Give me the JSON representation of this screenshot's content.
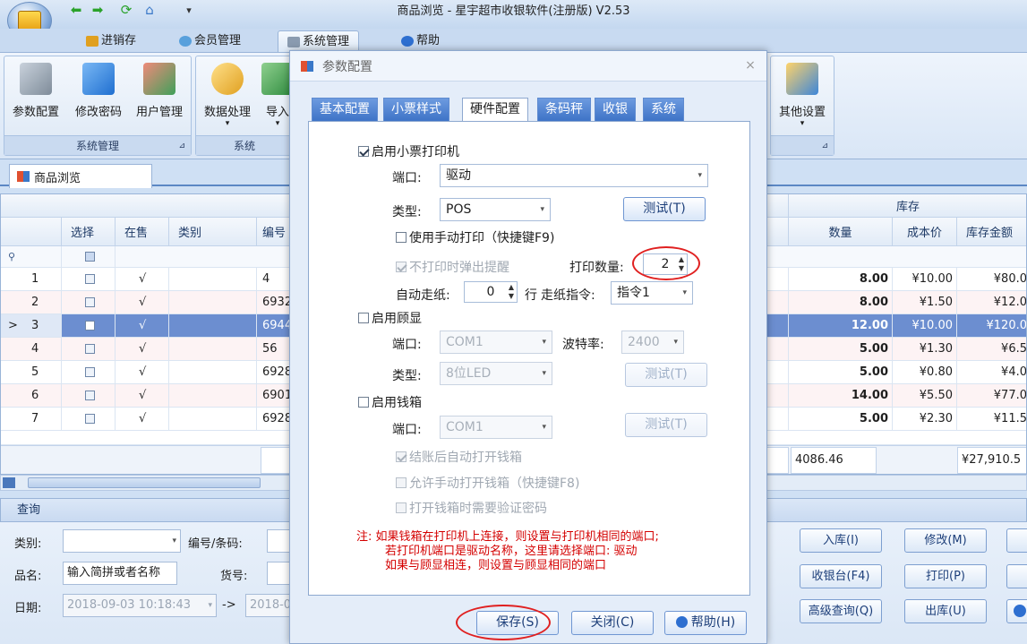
{
  "window": {
    "title": "商品浏览 - 星宇超市收银软件(注册版) V2.53"
  },
  "ribbon_tabs": [
    {
      "label": "进销存"
    },
    {
      "label": "会员管理"
    },
    {
      "label": "系统管理"
    },
    {
      "label": "帮助"
    }
  ],
  "ribbon": {
    "group1_label": "系统管理",
    "group2_label": "系统",
    "buttons": {
      "params": "参数配置",
      "password": "修改密码",
      "users": "用户管理",
      "data": "数据处理",
      "import": "导入",
      "other": "其他设置"
    }
  },
  "doc_tab": {
    "label": "商品浏览"
  },
  "grid": {
    "stock_group_header": "库存",
    "headers": {
      "select": "选择",
      "on_sale": "在售",
      "category": "类别",
      "code": "编号",
      "qty": "数量",
      "cost": "成本价",
      "stock_amount": "库存金额"
    },
    "rows": [
      {
        "n": "1",
        "on_sale": "√",
        "code": "4",
        "qty": "8.00",
        "cost": "¥10.00",
        "amount": "¥80.0"
      },
      {
        "n": "2",
        "on_sale": "√",
        "code": "6932",
        "qty": "8.00",
        "cost": "¥1.50",
        "amount": "¥12.0"
      },
      {
        "n": "3",
        "on_sale": "√",
        "code": "6944",
        "qty": "12.00",
        "cost": "¥10.00",
        "amount": "¥120.0"
      },
      {
        "n": "4",
        "on_sale": "√",
        "code": "56",
        "qty": "5.00",
        "cost": "¥1.30",
        "amount": "¥6.5"
      },
      {
        "n": "5",
        "on_sale": "√",
        "code": "6928",
        "qty": "5.00",
        "cost": "¥0.80",
        "amount": "¥4.0"
      },
      {
        "n": "6",
        "on_sale": "√",
        "code": "6901",
        "qty": "14.00",
        "cost": "¥5.50",
        "amount": "¥77.0"
      },
      {
        "n": "7",
        "on_sale": "√",
        "code": "6928",
        "qty": "5.00",
        "cost": "¥2.30",
        "amount": "¥11.5"
      }
    ],
    "current_row_marker": ">",
    "totals": {
      "qty": "4086.46",
      "amount": "¥27,910.5"
    }
  },
  "query": {
    "title": "查询",
    "category_label": "类别:",
    "code_label": "编号/条码:",
    "name_label": "品名:",
    "name_placeholder": "输入简拼或者名称",
    "sku_label": "货号:",
    "date_label": "日期:",
    "date_from": "2018-09-03 10:18:43",
    "date_arrow": "->",
    "date_to": "2018-0",
    "buttons": {
      "stock_in": "入库(I)",
      "modify": "修改(M)",
      "cashier": "收银台(F4)",
      "print": "打印(P)",
      "advanced": "高级查询(Q)",
      "stock_out": "出库(U)"
    }
  },
  "dialog": {
    "title": "参数配置",
    "close": "×",
    "tabs": [
      "基本配置",
      "小票样式",
      "硬件配置",
      "条码秤",
      "收银",
      "系统"
    ],
    "active_tab": "硬件配置",
    "printer": {
      "enable_label": "启用小票打印机",
      "port_label": "端口:",
      "port_value": "驱动",
      "type_label": "类型:",
      "type_value": "POS",
      "test_button": "测试(T)",
      "manual_print_label": "使用手动打印（快捷键F9)",
      "no_print_popup_label": "不打印时弹出提醒",
      "print_count_label": "打印数量:",
      "print_count_value": "2",
      "auto_feed_label": "自动走纸:",
      "auto_feed_value": "0",
      "line_label": "行",
      "feed_cmd_label": "走纸指令:",
      "feed_cmd_value": "指令1"
    },
    "display": {
      "enable_label": "启用顾显",
      "port_label": "端口:",
      "port_value": "COM1",
      "baud_label": "波特率:",
      "baud_value": "2400",
      "type_label": "类型:",
      "type_value": "8位LED",
      "test_button": "测试(T)"
    },
    "cashbox": {
      "enable_label": "启用钱箱",
      "port_label": "端口:",
      "port_value": "COM1",
      "test_button": "测试(T)",
      "auto_open_label": "结账后自动打开钱箱",
      "manual_open_label": "允许手动打开钱箱（快捷键F8)",
      "verify_label": "打开钱箱时需要验证密码"
    },
    "note_lines": [
      "注: 如果钱箱在打印机上连接，则设置与打印机相同的端口;",
      "若打印机端口是驱动名称，这里请选择端口: 驱动",
      "如果与顾显相连，则设置与顾显相同的端口"
    ],
    "buttons": {
      "save": "保存(S)",
      "close": "关闭(C)",
      "help": "帮助(H)"
    }
  },
  "colors": {
    "accent": "#3e73c7",
    "selected_row": "#6c8ed0",
    "note_red": "#d40000",
    "highlight_circle": "#e02020"
  }
}
